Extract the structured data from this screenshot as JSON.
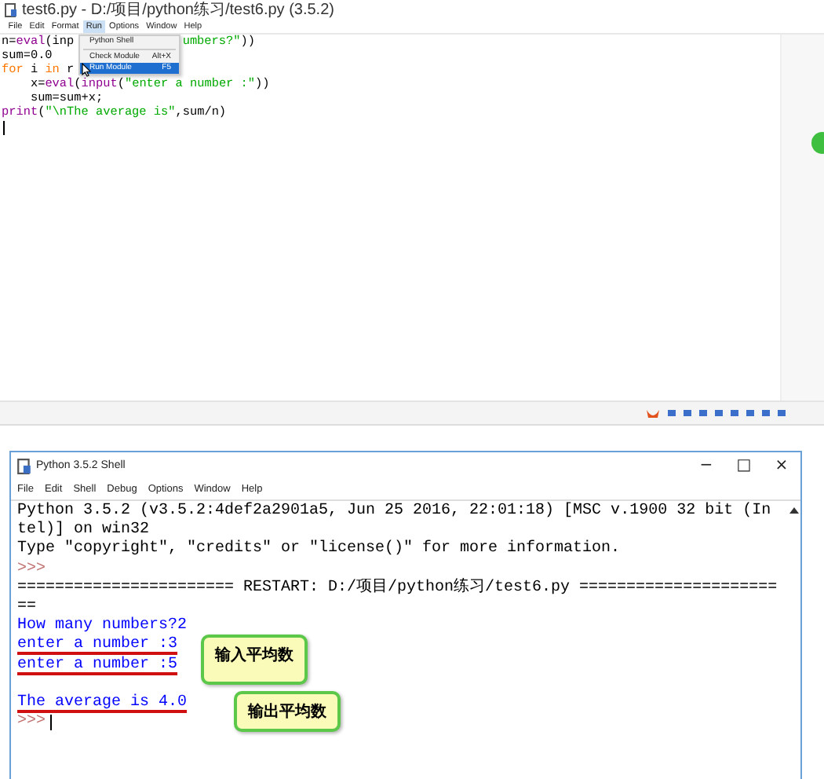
{
  "editor": {
    "title": "test6.py - D:/项目/python练习/test6.py (3.5.2)",
    "menu": [
      {
        "label": "File",
        "selected": false
      },
      {
        "label": "Edit",
        "selected": false
      },
      {
        "label": "Format",
        "selected": false
      },
      {
        "label": "Run",
        "selected": true
      },
      {
        "label": "Options",
        "selected": false
      },
      {
        "label": "Window",
        "selected": false
      },
      {
        "label": "Help",
        "selected": false
      }
    ],
    "dropdown": [
      {
        "label": "Python Shell",
        "selected": false,
        "divider_after": true
      },
      {
        "label": "Check Module",
        "shortcut": "Alt+X",
        "selected": false,
        "divider_after": false
      },
      {
        "label": "Run Module",
        "shortcut": "F5",
        "selected": true,
        "divider_after": false
      }
    ],
    "code": [
      {
        "tokens": [
          {
            "text": "n=",
            "kind": "plain"
          },
          {
            "text": "eval",
            "kind": "builtin"
          },
          {
            "text": "(inp",
            "kind": "plain"
          },
          {
            "text": "umbers?\"",
            "kind": "string",
            "after_menu": true
          },
          {
            "text": "))",
            "kind": "plain"
          }
        ]
      },
      {
        "tokens": [
          {
            "text": "sum=0.0",
            "kind": "plain"
          }
        ]
      },
      {
        "tokens": [
          {
            "text": "for",
            "kind": "keyword"
          },
          {
            "text": " i ",
            "kind": "plain"
          },
          {
            "text": "in",
            "kind": "keyword"
          },
          {
            "text": " r",
            "kind": "plain"
          }
        ]
      },
      {
        "tokens": [
          {
            "text": "    x=",
            "kind": "plain"
          },
          {
            "text": "eval",
            "kind": "builtin"
          },
          {
            "text": "(",
            "kind": "plain"
          },
          {
            "text": "input",
            "kind": "builtin"
          },
          {
            "text": "(",
            "kind": "plain"
          },
          {
            "text": "\"enter a number :\"",
            "kind": "string"
          },
          {
            "text": "))",
            "kind": "plain"
          }
        ]
      },
      {
        "tokens": [
          {
            "text": "    sum=sum+x;",
            "kind": "plain"
          }
        ]
      },
      {
        "tokens": [
          {
            "text": "print",
            "kind": "builtin"
          },
          {
            "text": "(",
            "kind": "plain"
          },
          {
            "text": "\"\\nThe average is\"",
            "kind": "string"
          },
          {
            "text": ",sum/n)",
            "kind": "plain"
          }
        ]
      }
    ]
  },
  "shell": {
    "title": "Python 3.5.2 Shell",
    "controls": [
      "−",
      "□",
      "×"
    ],
    "menu": [
      "File",
      "Edit",
      "Shell",
      "Debug",
      "Options",
      "Window",
      "Help"
    ],
    "lines": [
      {
        "text": "Python 3.5.2 (v3.5.2:4def2a2901a5, Jun 25 2016, 22:01:18) [MSC v.1900 32 bit (In",
        "kind": "console",
        "underlined": false,
        "cursor": false
      },
      {
        "text": "tel)] on win32",
        "kind": "console",
        "underlined": false,
        "cursor": false
      },
      {
        "text": "Type \"copyright\", \"credits\" or \"license()\" for more information.",
        "kind": "console",
        "underlined": false,
        "cursor": false
      },
      {
        "text": ">>>",
        "kind": "prompt",
        "underlined": false,
        "cursor": false
      },
      {
        "text": "======================= RESTART: D:/项目/python练习/test6.py =====================",
        "kind": "console",
        "underlined": false,
        "cursor": false
      },
      {
        "text": "==",
        "kind": "console",
        "underlined": false,
        "cursor": false
      },
      {
        "text": "How many numbers?2",
        "kind": "output",
        "underlined": false,
        "cursor": false
      },
      {
        "text": "enter a number :3",
        "kind": "output",
        "underlined": true,
        "cursor": false
      },
      {
        "text": "enter a number :5",
        "kind": "output",
        "underlined": true,
        "cursor": false,
        "gap_after": true
      },
      {
        "text": "The average is 4.0",
        "kind": "output",
        "underlined": true,
        "cursor": false
      },
      {
        "text": ">>>",
        "kind": "prompt",
        "underlined": false,
        "cursor": true
      }
    ],
    "callouts": [
      "输入平均数",
      "输出平均数"
    ]
  }
}
